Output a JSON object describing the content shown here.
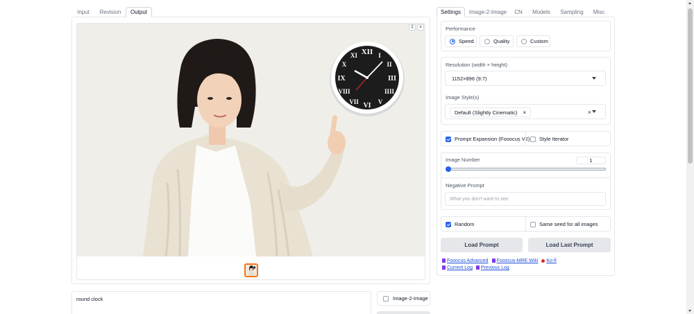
{
  "left_tabs": [
    {
      "label": "Input",
      "active": false
    },
    {
      "label": "Revision",
      "active": false
    },
    {
      "label": "Output",
      "active": true
    }
  ],
  "right_tabs": [
    {
      "label": "Settings",
      "active": true
    },
    {
      "label": "Image-2-Image",
      "active": false
    },
    {
      "label": "CN",
      "active": false
    },
    {
      "label": "Models",
      "active": false
    },
    {
      "label": "Sampling",
      "active": false
    },
    {
      "label": "Misc",
      "active": false
    }
  ],
  "gallery": {
    "download_icon": "download-icon",
    "close_icon": "close-icon",
    "image_subject": "woman-pointing-at-clock",
    "clock_numerals": [
      "XII",
      "I",
      "II",
      "III",
      "IIII",
      "V",
      "VI",
      "VII",
      "VIII",
      "IX",
      "X",
      "XI"
    ]
  },
  "prompt": {
    "value": "round clock"
  },
  "image2image_checkbox": {
    "label": "Image-2-Image",
    "checked": false
  },
  "performance": {
    "label": "Performance",
    "options": [
      {
        "label": "Speed",
        "selected": true
      },
      {
        "label": "Quality",
        "selected": false
      },
      {
        "label": "Custom",
        "selected": false
      }
    ]
  },
  "resolution": {
    "label": "Resolution (width × height)",
    "value": "1152×896 (9:7)"
  },
  "image_styles": {
    "label": "Image Style(s)",
    "chip": "Default (Slightly Cinematic)",
    "remove_glyph": "×",
    "clear_glyph": "×"
  },
  "prompt_expansion": {
    "label": "Prompt Expansion (Fooocus V2)",
    "checked": true
  },
  "style_iterator": {
    "label": "Style Iterator",
    "checked": false
  },
  "image_number": {
    "label": "Image Number",
    "value": "1",
    "fraction": 0.0
  },
  "negative_prompt": {
    "label": "Negative Prompt",
    "placeholder": "What you don't want to see."
  },
  "random": {
    "label": "Random",
    "checked": true
  },
  "same_seed": {
    "label": "Same seed for all images",
    "checked": false
  },
  "buttons": {
    "load_prompt": "Load Prompt",
    "load_last_prompt": "Load Last Prompt"
  },
  "links": {
    "fooocus_advanced": "Fooocus Advanced",
    "fooocus_mre_wiki": "Fooocus-MRE Wiki",
    "ko_fi": "Ko-fi",
    "current_log": "Current Log",
    "previous_log": "Previous Log"
  },
  "colors": {
    "accent": "#2563eb",
    "thumb_border": "#f97316",
    "link": "#1d4ed8"
  }
}
